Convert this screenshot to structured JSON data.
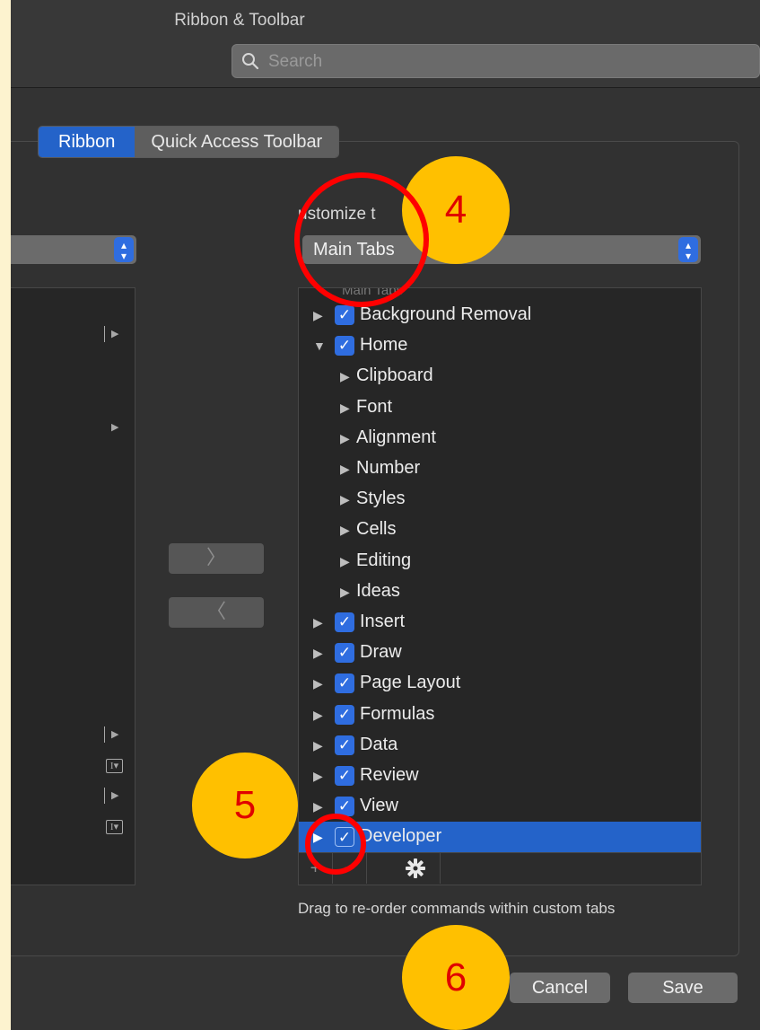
{
  "window": {
    "title": "Ribbon & Toolbar"
  },
  "search": {
    "placeholder": "Search"
  },
  "tabs": [
    {
      "label": "Ribbon",
      "active": true
    },
    {
      "label": "Quick Access Toolbar",
      "active": false
    }
  ],
  "customize": {
    "label": "Customize the Ribbon:",
    "label_visible": "ustomize t",
    "selected": "Main Tabs",
    "list_header": "Main Tabs"
  },
  "ribbon_tabs": [
    {
      "label": "Background Removal",
      "checked": true,
      "expanded": false,
      "level": 0
    },
    {
      "label": "Home",
      "checked": true,
      "expanded": true,
      "level": 0
    },
    {
      "label": "Clipboard",
      "level": 1
    },
    {
      "label": "Font",
      "level": 1
    },
    {
      "label": "Alignment",
      "level": 1
    },
    {
      "label": "Number",
      "level": 1
    },
    {
      "label": "Styles",
      "level": 1
    },
    {
      "label": "Cells",
      "level": 1
    },
    {
      "label": "Editing",
      "level": 1
    },
    {
      "label": "Ideas",
      "level": 1
    },
    {
      "label": "Insert",
      "checked": true,
      "expanded": false,
      "level": 0
    },
    {
      "label": "Draw",
      "checked": true,
      "expanded": false,
      "level": 0
    },
    {
      "label": "Page Layout",
      "checked": true,
      "expanded": false,
      "level": 0
    },
    {
      "label": "Formulas",
      "checked": true,
      "expanded": false,
      "level": 0
    },
    {
      "label": "Data",
      "checked": true,
      "expanded": false,
      "level": 0
    },
    {
      "label": "Review",
      "checked": true,
      "expanded": false,
      "level": 0
    },
    {
      "label": "View",
      "checked": true,
      "expanded": false,
      "level": 0
    },
    {
      "label": "Developer",
      "checked": true,
      "expanded": false,
      "level": 0,
      "selected": true
    }
  ],
  "list_toolbar": {
    "add": "+",
    "remove": "−"
  },
  "move_buttons": {
    "add": "〉",
    "remove": "〈"
  },
  "hint": "Drag to re-order commands within custom tabs",
  "buttons": {
    "cancel": "Cancel",
    "save": "Save"
  },
  "markers": [
    "4",
    "5",
    "6"
  ],
  "colors": {
    "accent": "#2463c9",
    "marker_fill": "#ffc000",
    "marker_ring": "#ff0000"
  }
}
